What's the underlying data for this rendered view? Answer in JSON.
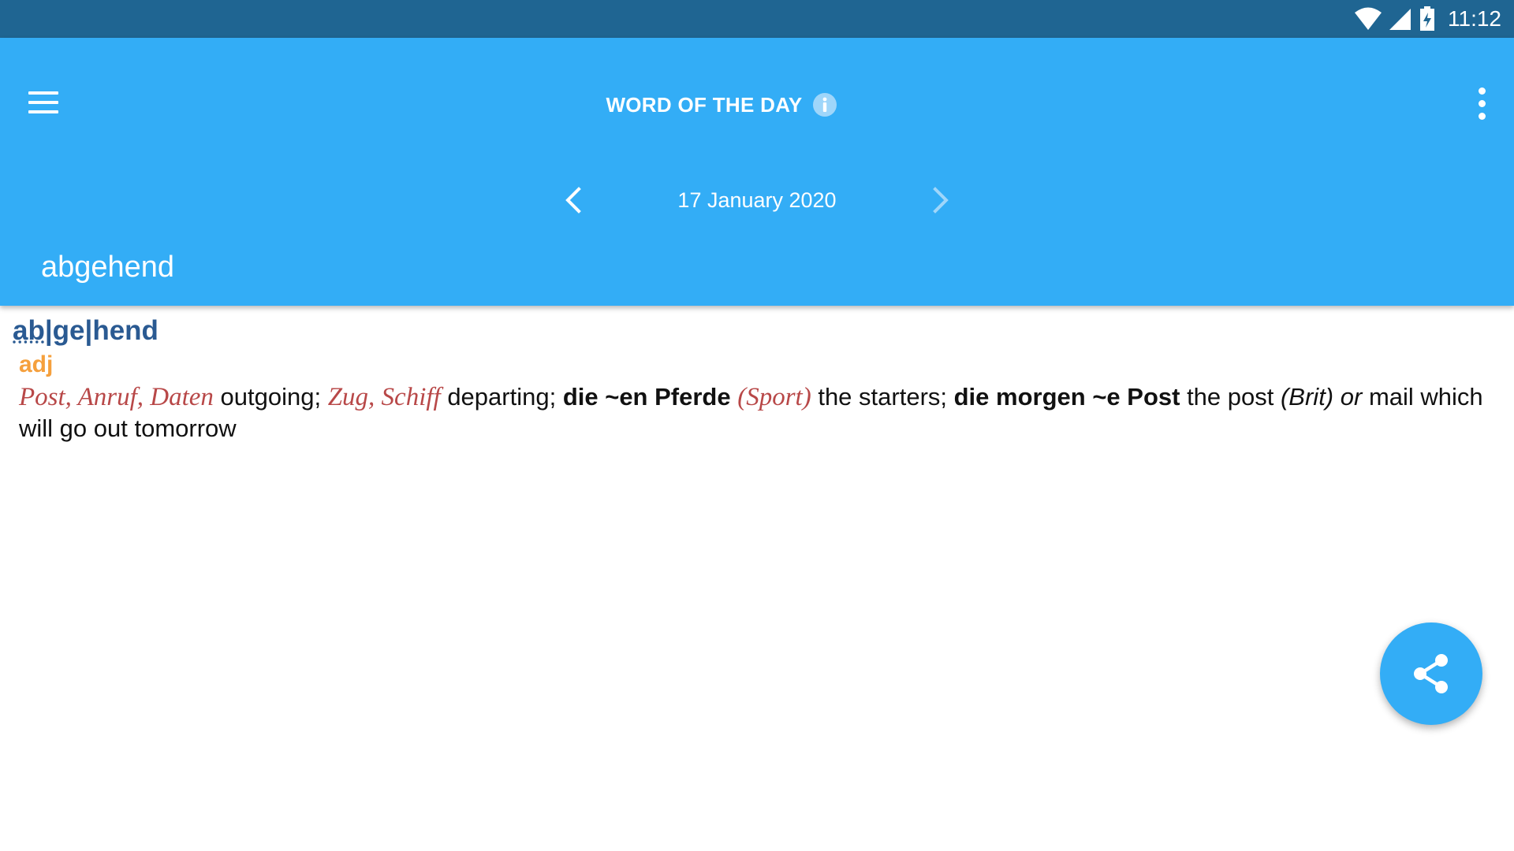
{
  "status_bar": {
    "time": "11:12",
    "icons": [
      "wifi-icon",
      "cell-signal-icon",
      "battery-charging-icon"
    ]
  },
  "app_bar": {
    "title": "WORD OF THE DAY",
    "menu_icon": "hamburger-menu-icon",
    "info_icon": "info-icon",
    "overflow_icon": "more-vert-icon",
    "date": "17 January 2020",
    "prev_icon": "chevron-left-icon",
    "next_icon": "chevron-right-icon",
    "headword": "abgehend",
    "colors": {
      "status_bar": "#1f6592",
      "app_bar": "#33adf6"
    }
  },
  "entry": {
    "headword_parts": [
      "ab",
      "|",
      "ge",
      "|",
      "hend"
    ],
    "part_of_speech": "adj",
    "definition": {
      "s1": "Post, Anruf, Daten",
      "s2": " outgoing; ",
      "s3": "Zug, Schiff",
      "s4": " departing; ",
      "s5": "die ~en Pferde",
      "s6": " ",
      "s7": "(Sport)",
      "s8": " the starters; ",
      "s9": "die morgen ~e Post",
      "s10": " the post ",
      "s11": "(Brit)",
      "s12": " ",
      "s13": "or",
      "s14": " mail which will go out tomorrow"
    },
    "colors": {
      "headword": "#2a5a92",
      "pos": "#f5a03d",
      "collocate": "#b84848"
    }
  },
  "fab": {
    "icon": "share-icon",
    "color": "#33adf6"
  }
}
